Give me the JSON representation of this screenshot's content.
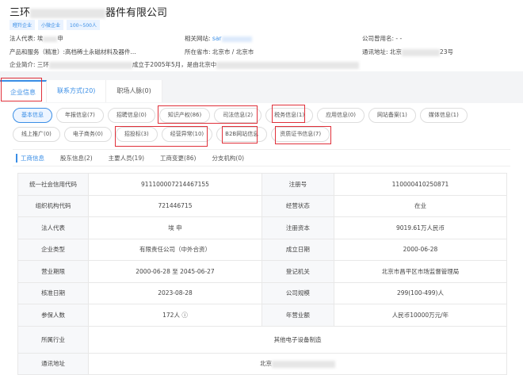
{
  "company": {
    "name_prefix": "三环",
    "name_suffix": "器件有限公司",
    "tags": [
      "瞪羚企业",
      "小微企业",
      "100~500人"
    ]
  },
  "info": {
    "legal_rep_label": "法人代表:",
    "legal_rep_value_prefix": "埃",
    "legal_rep_value_suffix": "申",
    "website_label": "相关网站:",
    "website_value": "sar",
    "former_name_label": "公司曾用名:",
    "former_name_value": "- -",
    "products_label": "产品和服务（精准）:",
    "products_value": "高档稀土永磁材料及器件...",
    "province_label": "所在省市:",
    "province_value": "北京市 / 北京市",
    "address_label": "通讯地址:",
    "address_prefix": "北京",
    "address_suffix": "23号",
    "intro_label": "企业简介:",
    "intro_prefix": "三环",
    "intro_middle": "成立于2005年5月，是由北京中"
  },
  "tabs": [
    {
      "label": "企业信息"
    },
    {
      "label": "联系方式(20)"
    },
    {
      "label": "职场人脉(0)"
    }
  ],
  "pills_row1": [
    "基本信息",
    "年报信息(7)",
    "招聘信息(0)",
    "知识产权(86)",
    "司法信息(2)",
    "税务信息(1)",
    "应用信息(0)",
    "网站备案(1)",
    "媒体信息(1)"
  ],
  "pills_row2": [
    "线上推广(0)",
    "电子商务(0)",
    "招投标(3)",
    "经营异常(10)",
    "B2B网站信息",
    "资质证书信息(7)"
  ],
  "subtabs": [
    "工商信息",
    "股东信息(2)",
    "主要人员(19)",
    "工商变更(86)",
    "分支机构(0)"
  ],
  "table": [
    [
      "统一社会信用代码",
      "911100007214467155",
      "注册号",
      "110000410250871"
    ],
    [
      "组织机构代码",
      "721446715",
      "经营状态",
      "在业"
    ],
    [
      "法人代表",
      "埃 申",
      "注册资本",
      "9019.61万人民币"
    ],
    [
      "企业类型",
      "有限责任公司（中外合资）",
      "成立日期",
      "2000-06-28"
    ],
    [
      "营业期限",
      "2000-06-28 至 2045-06-27",
      "登记机关",
      "北京市昌平区市场监督管理局"
    ],
    [
      "核准日期",
      "2023-08-28",
      "公司规模",
      "299(100-499)人"
    ],
    [
      "参保人数",
      "172人 ⓘ",
      "年营业额",
      "人民币10000万元/年"
    ]
  ],
  "industry_label": "所属行业",
  "industry_value": "其他电子设备制造",
  "address_row_label": "通讯地址",
  "address_row_value": "北京"
}
